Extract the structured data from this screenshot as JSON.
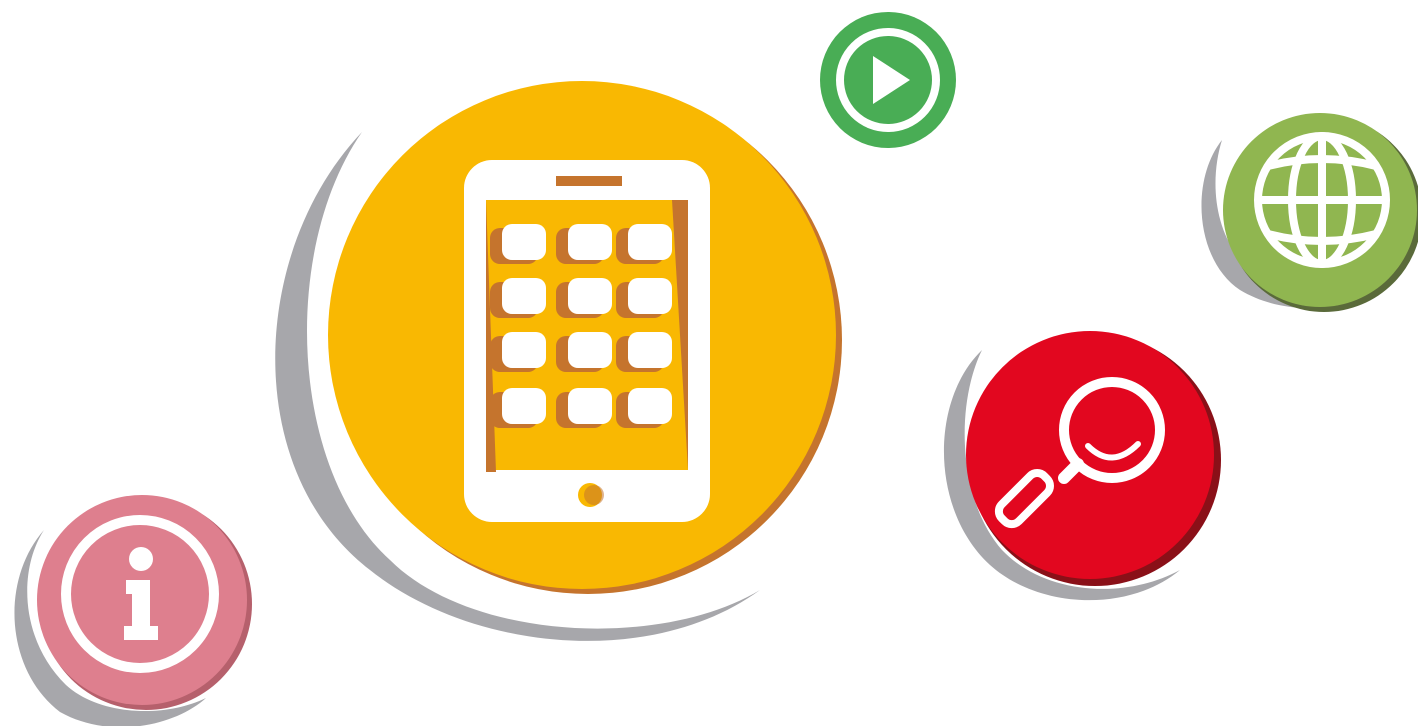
{
  "colors": {
    "background": "#ffffff",
    "shadow": "#a7a7ab",
    "tablet_circle": "#f9b802",
    "tablet_circle_edge": "#c5742d",
    "play_circle": "#49ad55",
    "globe_circle": "#90b650",
    "globe_circle_edge": "#5a6a3a",
    "search_circle": "#e2071f",
    "search_circle_edge": "#8a1018",
    "info_circle": "#de7f8e",
    "info_circle_edge": "#b6606c",
    "icon_foreground": "#ffffff"
  },
  "icons": [
    {
      "name": "tablet-apps-icon",
      "circle_color": "tablet_circle"
    },
    {
      "name": "play-icon",
      "circle_color": "play_circle"
    },
    {
      "name": "globe-icon",
      "circle_color": "globe_circle"
    },
    {
      "name": "search-icon",
      "circle_color": "search_circle"
    },
    {
      "name": "info-icon",
      "circle_color": "info_circle"
    }
  ]
}
